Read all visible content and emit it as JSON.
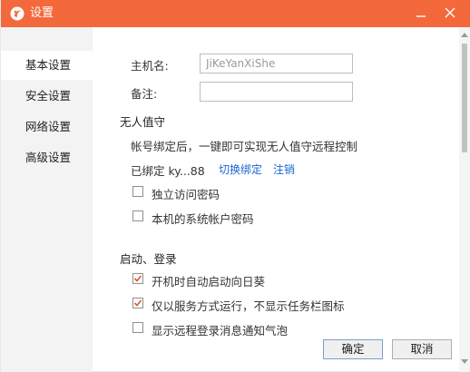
{
  "window": {
    "title": "设置",
    "accent_color": "#f4693c",
    "icons": [
      "app-logo-icon",
      "minimize-icon",
      "close-icon"
    ]
  },
  "sidebar": {
    "items": [
      {
        "label": "基本设置",
        "active": true
      },
      {
        "label": "安全设置",
        "active": false
      },
      {
        "label": "网络设置",
        "active": false
      },
      {
        "label": "高级设置",
        "active": false
      }
    ]
  },
  "basic": {
    "hostname_label": "主机名:",
    "hostname_placeholder": "JiKeYanXiShe",
    "note_label": "备注:",
    "note_value": ""
  },
  "unattended": {
    "title": "无人值守",
    "desc": "帐号绑定后，一键即可实现无人值守远程控制",
    "bound_text": "已绑定 ky...88",
    "switch_link": "切换绑定",
    "logout_link": "注销",
    "options": [
      {
        "label": "独立访问密码",
        "checked": false
      },
      {
        "label": "本机的系统帐户密码",
        "checked": false
      }
    ]
  },
  "startup": {
    "title": "启动、登录",
    "options": [
      {
        "label": "开机时自动启动向日葵",
        "checked": true
      },
      {
        "label": "仅以服务方式运行，不显示任务栏图标",
        "checked": true
      },
      {
        "label": "显示远程登录消息通知气泡",
        "checked": false
      }
    ]
  },
  "footer": {
    "ok_label": "确定",
    "cancel_label": "取消"
  }
}
